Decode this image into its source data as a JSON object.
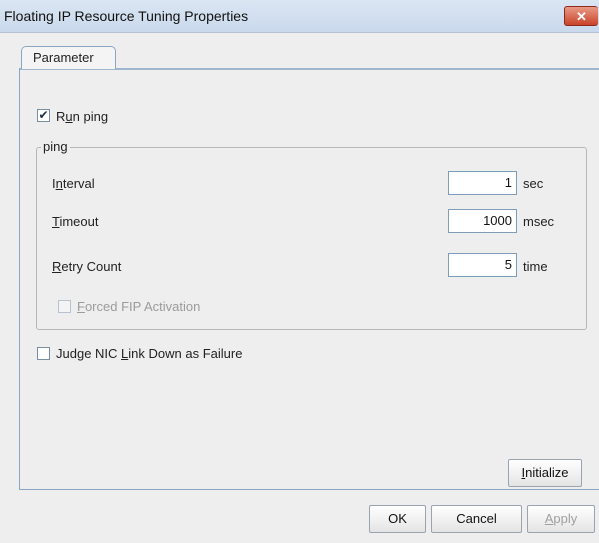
{
  "window": {
    "title": "Floating IP Resource Tuning Properties",
    "close_glyph": "✕"
  },
  "tabs": [
    {
      "label": "Parameter"
    }
  ],
  "run_ping": {
    "label_pre": "R",
    "label_mnemonic": "u",
    "label_post": "n ping",
    "checked": true,
    "check_glyph": "✔"
  },
  "ping_group": {
    "legend": "ping",
    "interval": {
      "label_pre": "I",
      "label_mnemonic": "n",
      "label_post": "terval",
      "value": "1",
      "unit": "sec"
    },
    "timeout": {
      "label_pre": "",
      "label_mnemonic": "T",
      "label_post": "imeout",
      "value": "1000",
      "unit": "msec"
    },
    "retry_count": {
      "label_pre": "",
      "label_mnemonic": "R",
      "label_post": "etry Count",
      "value": "5",
      "unit": "time"
    },
    "forced_fip": {
      "label_pre": "",
      "label_mnemonic": "F",
      "label_post": "orced FIP Activation",
      "checked": false,
      "enabled": false
    }
  },
  "judge_nic": {
    "label_pre": "Judge NIC ",
    "label_mnemonic": "L",
    "label_post": "ink Down as Failure",
    "checked": false
  },
  "buttons": {
    "initialize": {
      "label_pre": "",
      "label_mnemonic": "I",
      "label_post": "nitialize"
    },
    "ok": "OK",
    "cancel": "Cancel",
    "apply": {
      "label_pre": "",
      "label_mnemonic": "A",
      "label_post": "pply",
      "enabled": false
    }
  }
}
